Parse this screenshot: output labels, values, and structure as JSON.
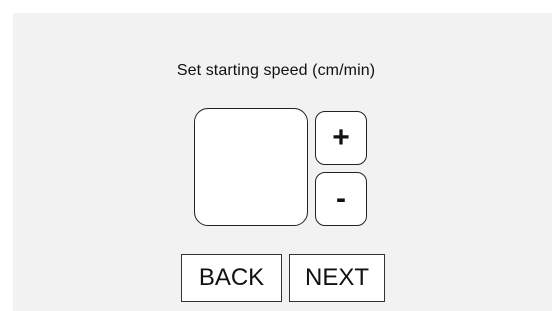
{
  "screen": {
    "prompt": "Set starting speed (cm/min)"
  },
  "speed": {
    "value": ""
  },
  "stepper": {
    "increment_label": "+",
    "decrement_label": "-"
  },
  "nav": {
    "back_label": "BACK",
    "next_label": "NEXT"
  },
  "colors": {
    "panel_background": "#f2f2f2",
    "button_background": "#ffffff",
    "border": "#222222",
    "text": "#111111"
  }
}
